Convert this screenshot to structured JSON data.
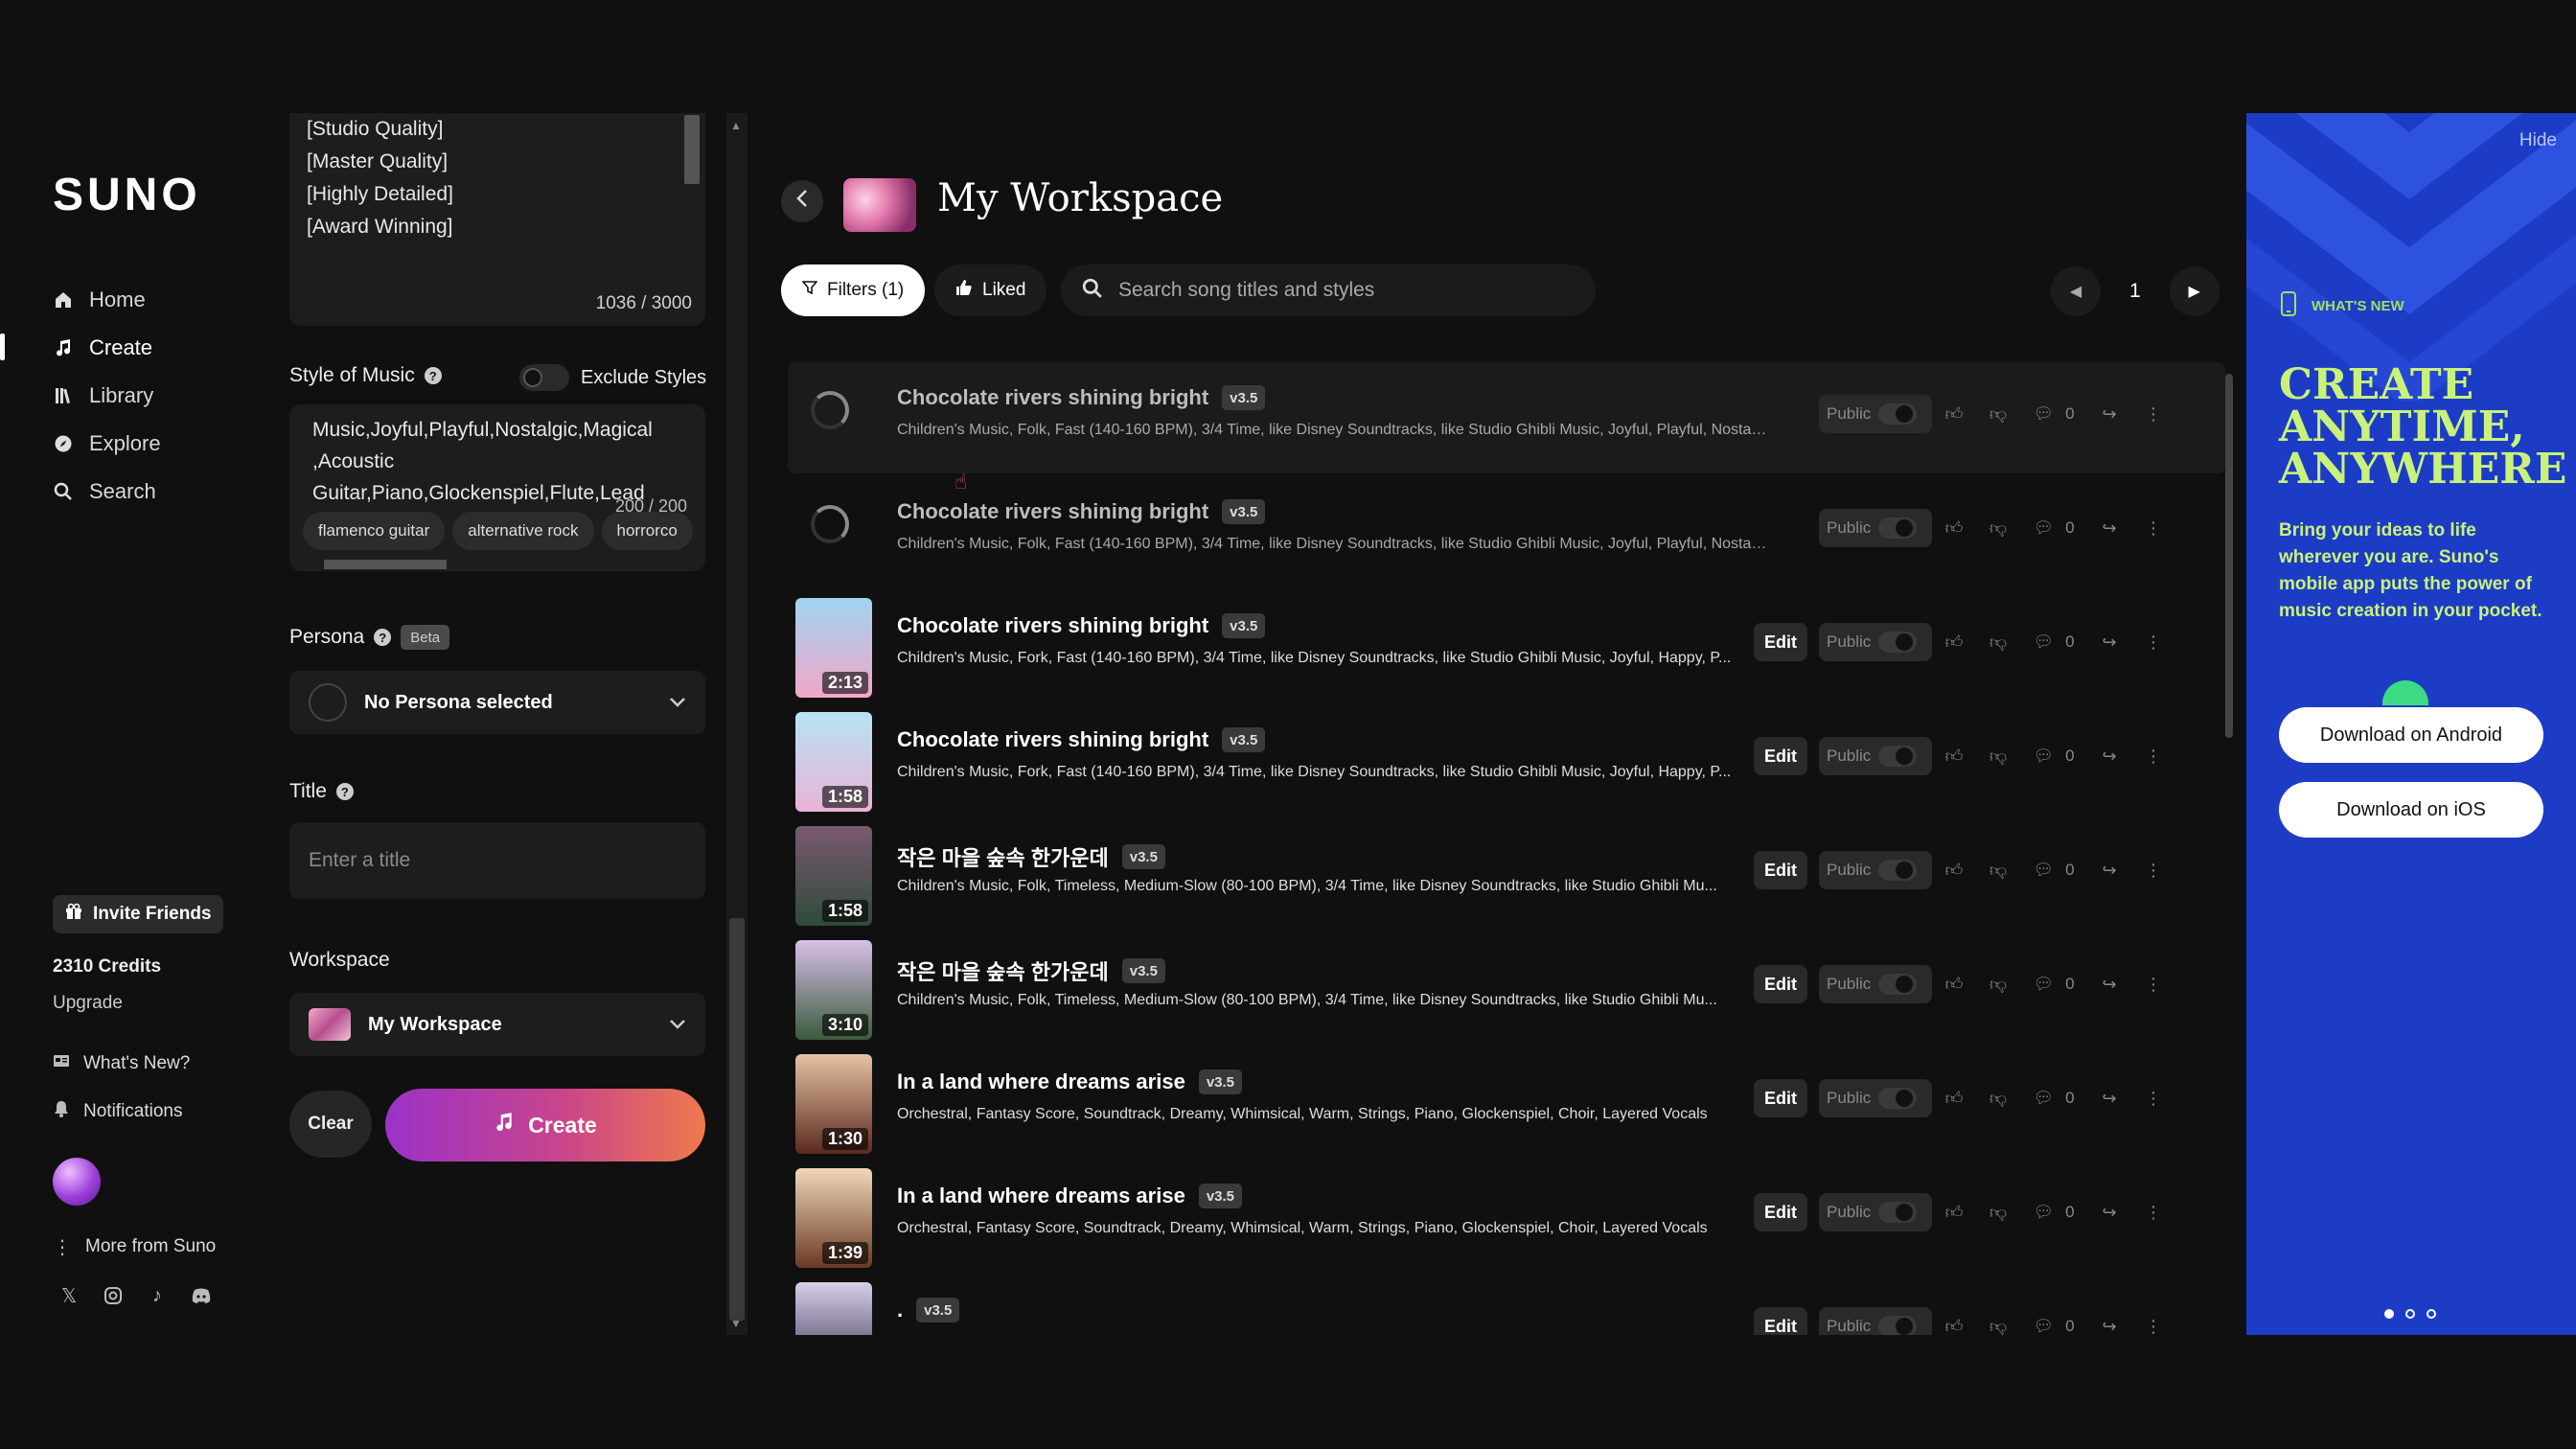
{
  "nav": {
    "logo": "SUNO",
    "items": [
      {
        "label": "Home",
        "icon": "home-icon"
      },
      {
        "label": "Create",
        "icon": "music-note-icon"
      },
      {
        "label": "Library",
        "icon": "library-icon"
      },
      {
        "label": "Explore",
        "icon": "compass-icon"
      },
      {
        "label": "Search",
        "icon": "search-icon"
      }
    ],
    "invite": "Invite Friends",
    "credits": "2310 Credits",
    "upgrade": "Upgrade",
    "whats_new": "What's New?",
    "notifications": "Notifications",
    "more": "More from Suno"
  },
  "create_panel": {
    "lyrics_lines": [
      "[Studio Quality]",
      "[Master Quality]",
      "[Highly Detailed]",
      "[Award Winning]"
    ],
    "lyrics_count": "1036 / 3000",
    "style_label": "Style of Music",
    "exclude_label": "Exclude Styles",
    "style_text": "Music,Joyful,Playful,Nostalgic,Magical ,Acoustic Guitar,Piano,Glockenspiel,Flute,Lead",
    "style_count": "200 / 200",
    "style_chips": [
      "flamenco guitar",
      "alternative rock",
      "horrorco"
    ],
    "persona_label": "Persona",
    "persona_badge": "Beta",
    "persona_value": "No Persona selected",
    "title_label": "Title",
    "title_placeholder": "Enter a title",
    "workspace_label": "Workspace",
    "workspace_value": "My Workspace",
    "clear_label": "Clear",
    "create_label": "Create"
  },
  "main": {
    "title": "My Workspace",
    "filters_label": "Filters (1)",
    "liked_label": "Liked",
    "search_placeholder": "Search song titles and styles",
    "page": "1",
    "edit_label": "Edit",
    "public_label": "Public",
    "songs": [
      {
        "title": "Chocolate rivers shining bright",
        "version": "v3.5",
        "tags": "Children's Music, Folk, Fast (140-160 BPM), 3/4 Time, like Disney Soundtracks, like Studio Ghibli Music, Joyful, Playful, Nostalgic, ...",
        "duration": "",
        "loading": true,
        "comments": "0",
        "art": [
          "#666",
          "#444"
        ]
      },
      {
        "title": "Chocolate rivers shining bright",
        "version": "v3.5",
        "tags": "Children's Music, Folk, Fast (140-160 BPM), 3/4 Time, like Disney Soundtracks, like Studio Ghibli Music, Joyful, Playful, Nostalgic, ...",
        "duration": "",
        "loading": true,
        "comments": "0",
        "art": [
          "#666",
          "#444"
        ]
      },
      {
        "title": "Chocolate rivers shining bright",
        "version": "v3.5",
        "tags": "Children's Music, Fork, Fast (140-160 BPM), 3/4 Time, like Disney Soundtracks, like Studio Ghibli Music, Joyful, Happy, P...",
        "duration": "2:13",
        "loading": false,
        "comments": "0",
        "art": [
          "#9fd4f0",
          "#f3a6c9"
        ]
      },
      {
        "title": "Chocolate rivers shining bright",
        "version": "v3.5",
        "tags": "Children's Music, Fork, Fast (140-160 BPM), 3/4 Time, like Disney Soundtracks, like Studio Ghibli Music, Joyful, Happy, P...",
        "duration": "1:58",
        "loading": false,
        "comments": "0",
        "art": [
          "#b7e3f4",
          "#e9b3d6"
        ]
      },
      {
        "title": "작은 마을 숲속 한가운데",
        "version": "v3.5",
        "tags": "Children's Music, Folk, Timeless, Medium-Slow (80-100 BPM), 3/4 Time, like Disney Soundtracks, like Studio Ghibli Mu...",
        "duration": "1:58",
        "loading": false,
        "comments": "0",
        "art": [
          "#7a5a70",
          "#2f4a3a"
        ]
      },
      {
        "title": "작은 마을 숲속 한가운데",
        "version": "v3.5",
        "tags": "Children's Music, Folk, Timeless, Medium-Slow (80-100 BPM), 3/4 Time, like Disney Soundtracks, like Studio Ghibli Mu...",
        "duration": "3:10",
        "loading": false,
        "comments": "0",
        "art": [
          "#d8c0e8",
          "#3b5a3c"
        ]
      },
      {
        "title": "In a land where dreams arise",
        "version": "v3.5",
        "tags": "Orchestral, Fantasy Score, Soundtrack, Dreamy, Whimsical, Warm, Strings, Piano, Glockenspiel, Choir, Layered Vocals",
        "duration": "1:30",
        "loading": false,
        "comments": "0",
        "art": [
          "#e6c2a4",
          "#5b2a1e"
        ]
      },
      {
        "title": "In a land where dreams arise",
        "version": "v3.5",
        "tags": "Orchestral, Fantasy Score, Soundtrack, Dreamy, Whimsical, Warm, Strings, Piano, Glockenspiel, Choir, Layered Vocals",
        "duration": "1:39",
        "loading": false,
        "comments": "0",
        "art": [
          "#f0d8b8",
          "#6a3a22"
        ]
      },
      {
        "title": ".",
        "version": "v3.5",
        "tags": "",
        "duration": "",
        "loading": false,
        "comments": "0",
        "art": [
          "#d8d0e8",
          "#30284a"
        ]
      }
    ]
  },
  "promo": {
    "hide": "Hide",
    "tag": "WHAT'S NEW",
    "headline": "CREATE ANYTIME, ANYWHERE",
    "text": "Bring your ideas to life wherever you are. Suno's mobile app puts the power of music creation in your pocket.",
    "android": "Download on Android",
    "ios": "Download on iOS",
    "accent": "#c9f27a",
    "bg": "#1d3cc5"
  }
}
